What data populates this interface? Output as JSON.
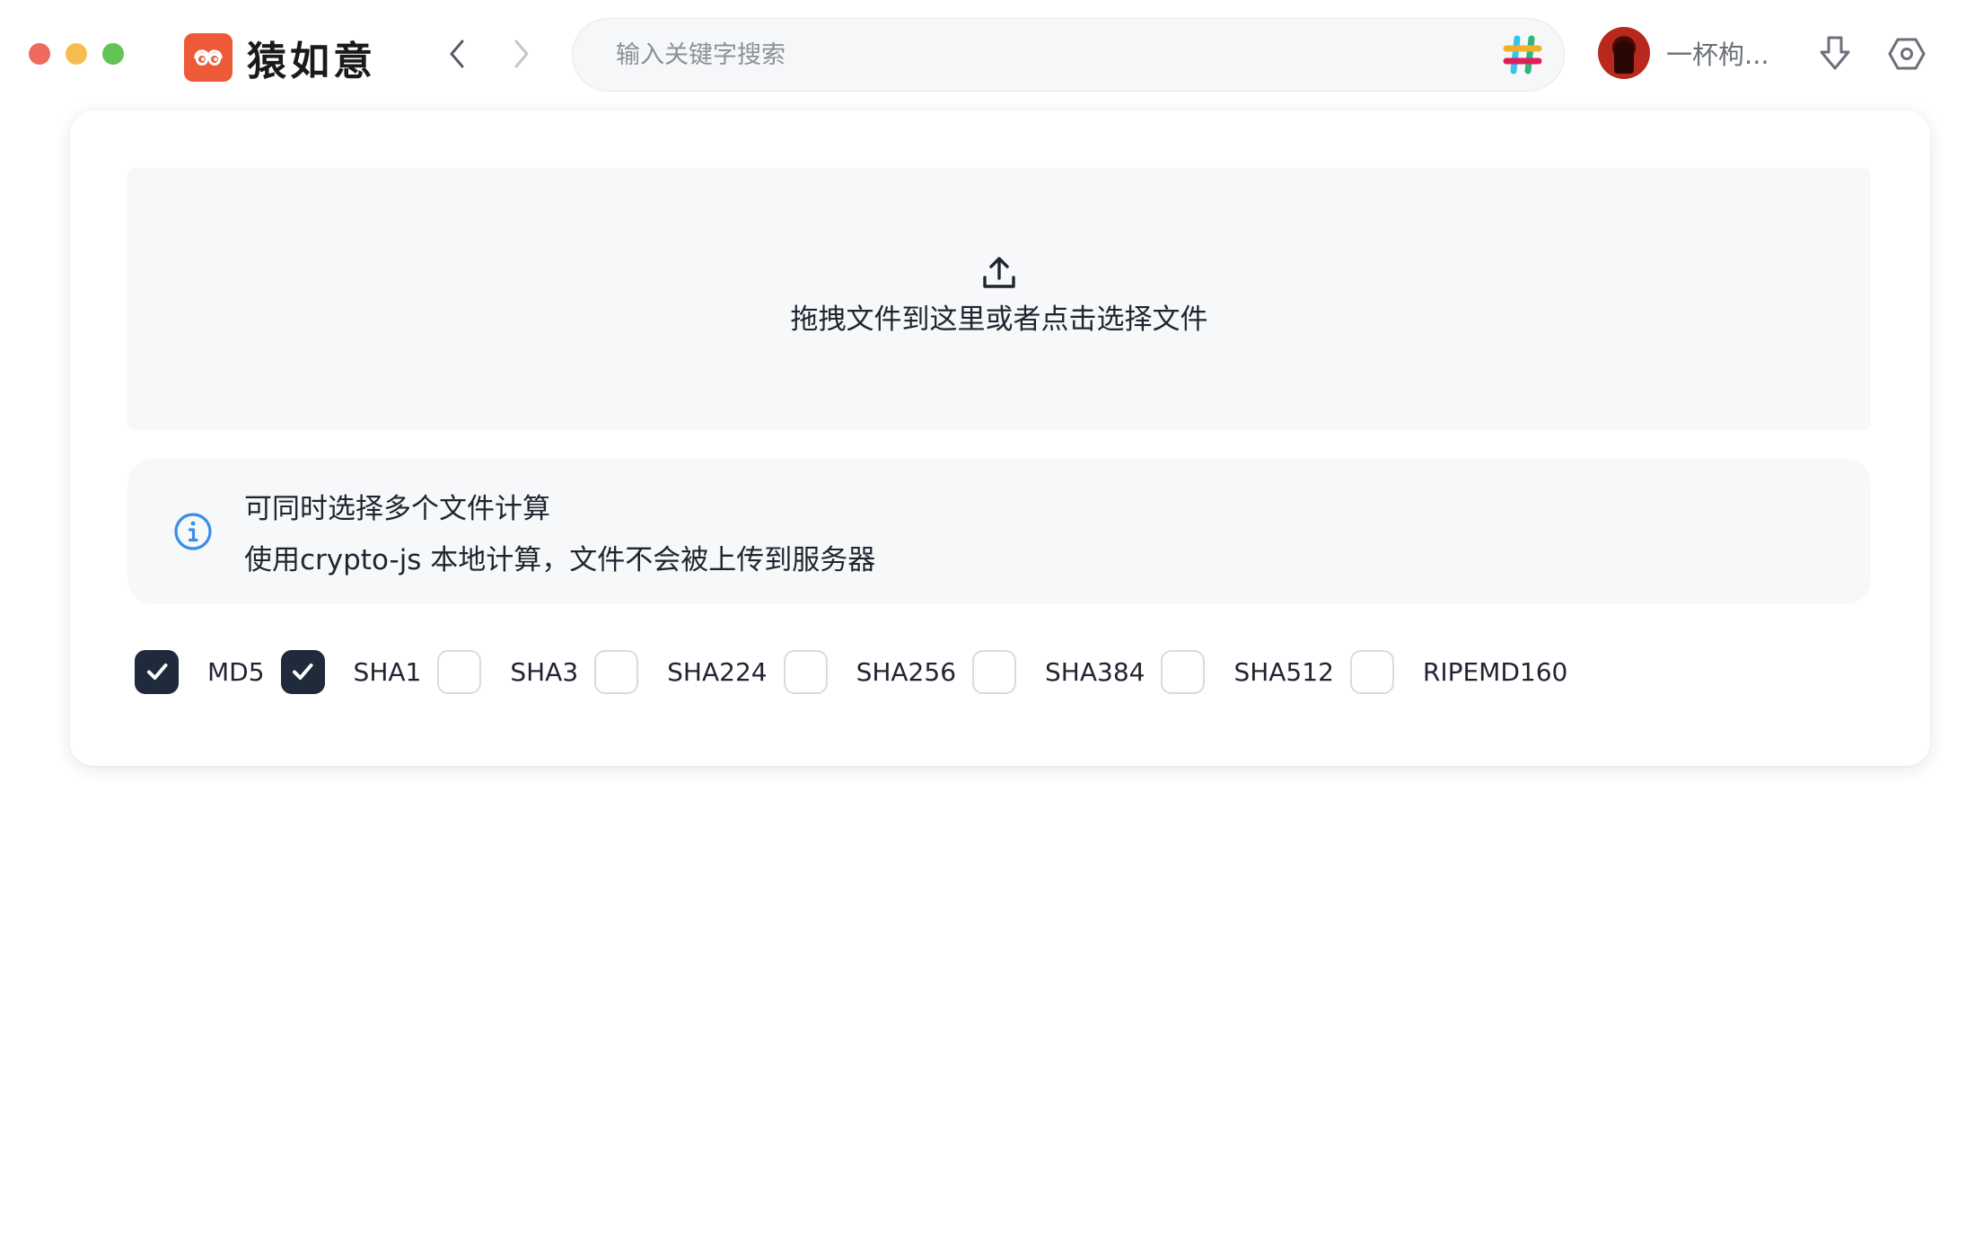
{
  "window": {
    "traffic_lights": [
      "close",
      "minimize",
      "maximize"
    ]
  },
  "brand": {
    "name": "猿如意",
    "logo_icon": "eyes-logo-icon",
    "color": "#ee5a38"
  },
  "nav": {
    "back_icon": "chevron-left-icon",
    "forward_icon": "chevron-right-icon"
  },
  "search": {
    "placeholder": "输入关键字搜索",
    "value": "",
    "tag_icon": "hashtag-icon"
  },
  "user": {
    "name": "一杯枸...",
    "avatar_icon": "avatar"
  },
  "toolbar": {
    "download_icon": "download-icon",
    "settings_icon": "settings-icon"
  },
  "upload": {
    "icon": "upload-icon",
    "text": "拖拽文件到这里或者点击选择文件"
  },
  "info": {
    "icon": "info-icon",
    "accent": "#3a8ee6",
    "lines": [
      "可同时选择多个文件计算",
      "使用crypto-js 本地计算，文件不会被上传到服务器"
    ]
  },
  "algorithms": [
    {
      "label": "MD5",
      "checked": true
    },
    {
      "label": "SHA1",
      "checked": true
    },
    {
      "label": "SHA3",
      "checked": false
    },
    {
      "label": "SHA224",
      "checked": false
    },
    {
      "label": "SHA256",
      "checked": false
    },
    {
      "label": "SHA384",
      "checked": false
    },
    {
      "label": "SHA512",
      "checked": false
    },
    {
      "label": "RIPEMD160",
      "checked": false
    }
  ],
  "colors": {
    "checkbox_checked": "#1f2a3a",
    "checkbox_border": "#d9dbe0"
  }
}
